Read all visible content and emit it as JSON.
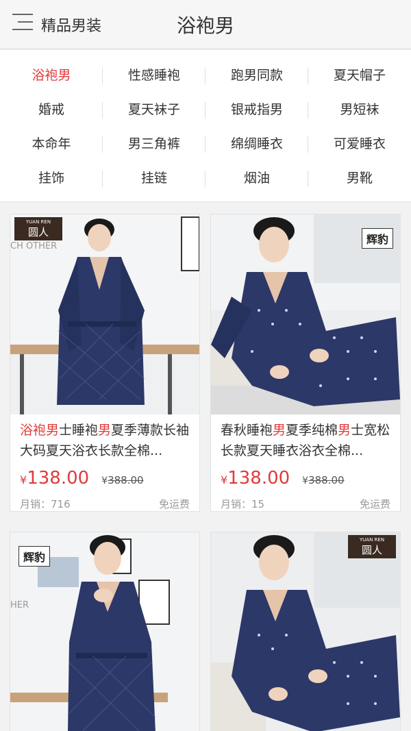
{
  "header": {
    "category": "精品男装",
    "title": "浴袍男"
  },
  "tags": [
    [
      "浴袍男",
      "性感睡袍",
      "跑男同款",
      "夏天帽子"
    ],
    [
      "婚戒",
      "夏天袜子",
      "银戒指男",
      "男短袜"
    ],
    [
      "本命年",
      "男三角裤",
      "绵绸睡衣",
      "可爱睡衣"
    ],
    [
      "挂饰",
      "挂链",
      "烟油",
      "男靴"
    ]
  ],
  "products": [
    {
      "brand_small": "YUAN REN",
      "brand_big": "圆人",
      "title_parts": [
        "浴袍男",
        "士睡袍",
        "男",
        "夏季薄款长袖大码夏天浴衣长款全棉..."
      ],
      "currency": "¥",
      "price": "138.00",
      "old_price": "388.00",
      "sales": "月销：716",
      "shipping": "免运费"
    },
    {
      "brand_big": "辉豹",
      "title_parts": [
        "春秋睡袍",
        "男",
        "夏季纯棉",
        "男",
        "士宽松长款夏天睡衣浴衣全棉..."
      ],
      "currency": "¥",
      "price": "138.00",
      "old_price": "388.00",
      "sales": "月销：15",
      "shipping": "免运费"
    },
    {
      "brand_big": "辉豹"
    },
    {
      "brand_small": "YUAN REN",
      "brand_big": "圆人"
    }
  ],
  "photo_text": {
    "left_wall": "CH OTHER",
    "left_wall2": "HER"
  },
  "colors": {
    "accent": "#e23a3a",
    "robe": "#2c3868"
  }
}
